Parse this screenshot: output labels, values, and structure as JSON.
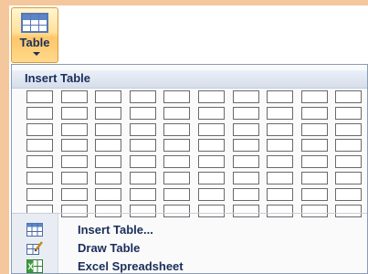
{
  "ribbon": {
    "table_label": "Table"
  },
  "menu": {
    "header": "Insert Table",
    "grid": {
      "columns": 10,
      "rows": 8
    },
    "items": [
      {
        "label": "Insert Table...",
        "icon": "insert-table-icon"
      },
      {
        "label": "Draw Table",
        "icon": "draw-table-icon"
      },
      {
        "label": "Excel Spreadsheet",
        "icon": "excel-spreadsheet-icon"
      }
    ]
  },
  "colors": {
    "accent": "#ffc76a",
    "text": "#1a2d5a",
    "page": "#f5c79d"
  }
}
